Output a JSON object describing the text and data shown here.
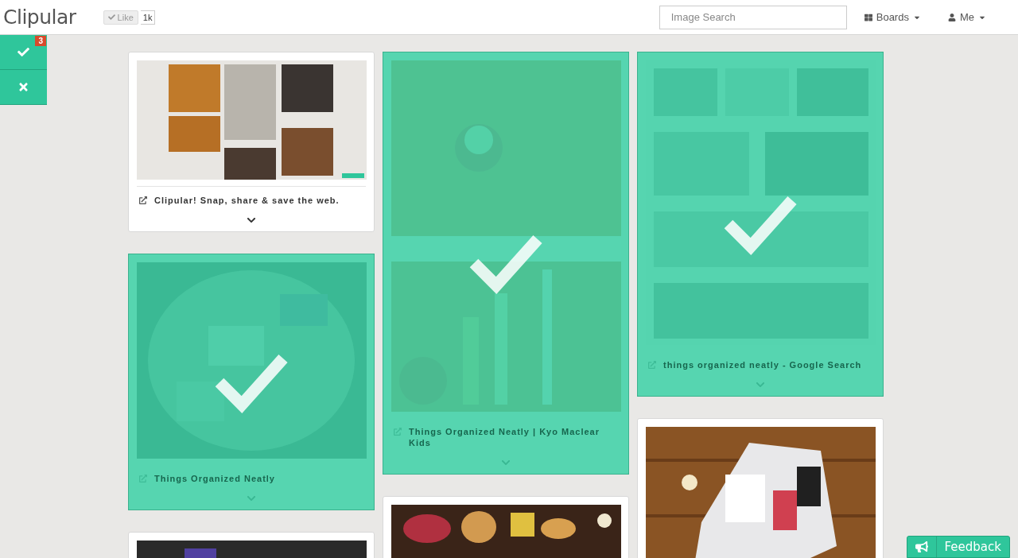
{
  "header": {
    "logo": "Clipular",
    "like": {
      "label": "Like",
      "count": "1k"
    },
    "search": {
      "placeholder": "Image Search"
    },
    "menus": [
      {
        "kind": "boards",
        "label": "Boards"
      },
      {
        "kind": "user",
        "label": "Me"
      }
    ]
  },
  "selection_bar": {
    "count": "3"
  },
  "columns": [
    {
      "cards": [
        {
          "title": "Clipular! Snap, share & save the web.",
          "selected": false
        },
        {
          "title": "Things Organized Neatly",
          "selected": true
        },
        {
          "selected": false
        }
      ]
    },
    {
      "cards": [
        {
          "title": "Things Organized Neatly | Kyo Maclear Kids",
          "selected": true
        },
        {
          "selected": false
        }
      ]
    },
    {
      "cards": [
        {
          "title": "things organized neatly - Google Search",
          "selected": true
        },
        {
          "selected": false
        }
      ]
    }
  ],
  "feedback": {
    "label": "Feedback"
  }
}
